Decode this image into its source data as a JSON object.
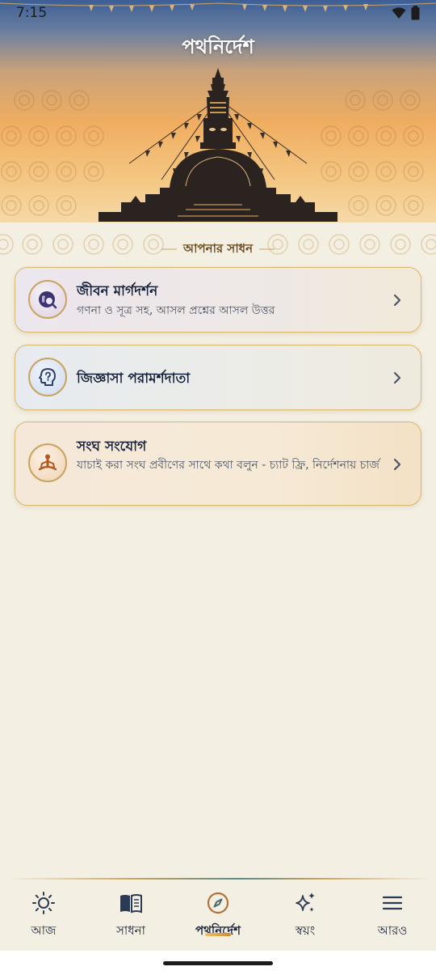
{
  "status_bar": {
    "time": "7:15",
    "icons": [
      "wifi-icon",
      "battery-icon"
    ]
  },
  "header": {
    "title": "পথনির্দেশ"
  },
  "section": {
    "title": "আপনার সাধন"
  },
  "cards": [
    {
      "title": "জীবন মার্গদর্শন",
      "subtitle": "গণনা ও সূত্র সহ, আসল প্রশ্নের আসল উত্তর",
      "icon": "globe-search-icon"
    },
    {
      "title": "জিজ্ঞাসা পরামর্শদাতা",
      "subtitle": "",
      "icon": "head-question-icon"
    },
    {
      "title": "সংঘ সংযোগ",
      "subtitle": "যাচাই করা সংঘ প্রবীণের সাথে কথা বলুন - চ্যাট ফ্রি, নির্দেশনায় চার্জ",
      "icon": "meditation-icon"
    }
  ],
  "bottom_nav": [
    {
      "label": "আজ",
      "icon": "sun-icon",
      "active": false
    },
    {
      "label": "সাধনা",
      "icon": "book-icon",
      "active": false
    },
    {
      "label": "পথনির্দেশ",
      "icon": "compass-icon",
      "active": true
    },
    {
      "label": "স্বয়ং",
      "icon": "sparkles-icon",
      "active": false
    },
    {
      "label": "আরও",
      "icon": "menu-icon",
      "active": false
    }
  ],
  "colors": {
    "background": "#f4efe3",
    "card_border": "#d8b76c",
    "accent": "#d08a2c",
    "text": "#17223a"
  }
}
